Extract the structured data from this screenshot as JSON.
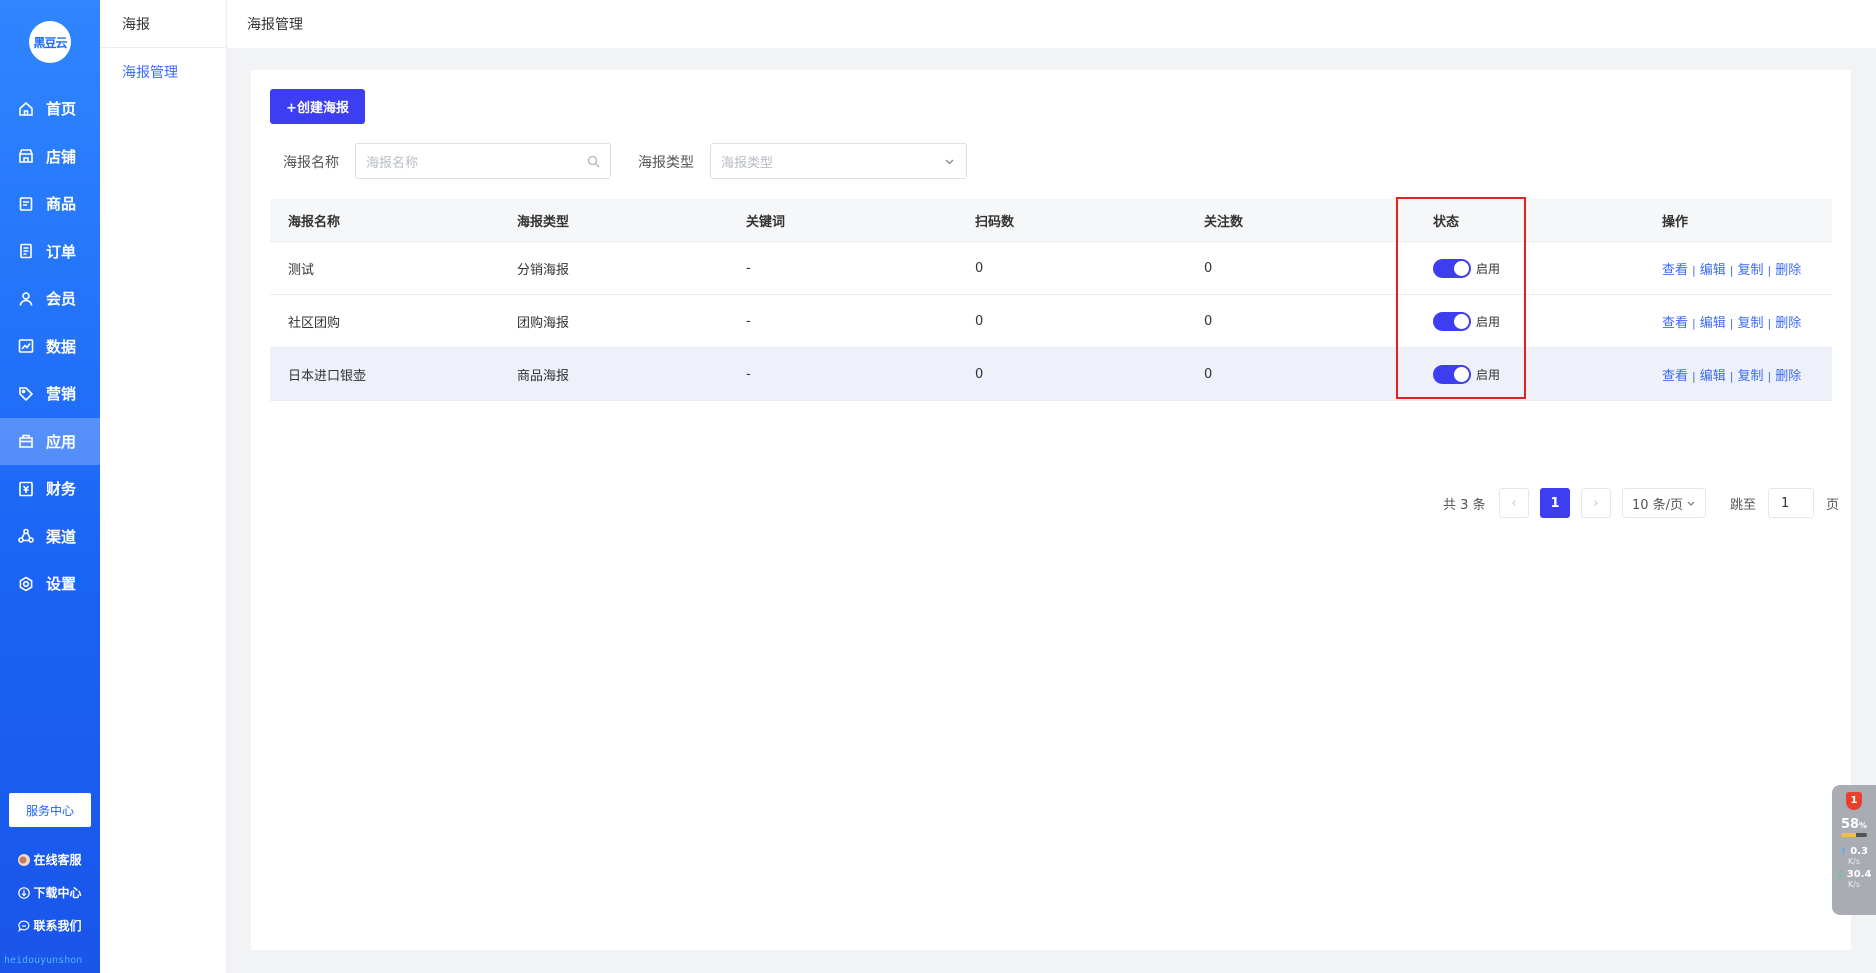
{
  "brand": {
    "logo_text": "黑豆云",
    "footer": "heidouyunshon"
  },
  "nav": {
    "items": [
      {
        "label": "首页",
        "icon": "home-icon"
      },
      {
        "label": "店铺",
        "icon": "store-icon"
      },
      {
        "label": "商品",
        "icon": "goods-icon"
      },
      {
        "label": "订单",
        "icon": "order-icon"
      },
      {
        "label": "会员",
        "icon": "member-icon"
      },
      {
        "label": "数据",
        "icon": "data-icon"
      },
      {
        "label": "营销",
        "icon": "tag-icon"
      },
      {
        "label": "应用",
        "icon": "app-icon",
        "active": true
      },
      {
        "label": "财务",
        "icon": "finance-icon"
      },
      {
        "label": "渠道",
        "icon": "channel-icon"
      },
      {
        "label": "设置",
        "icon": "settings-icon"
      }
    ],
    "service_center": "服务中心",
    "links": [
      "在线客服",
      "下载中心",
      "联系我们"
    ]
  },
  "subnav": {
    "title": "海报",
    "items": [
      "海报管理"
    ]
  },
  "breadcrumb": "海报管理",
  "toolbar": {
    "create_label": "+创建海报"
  },
  "filters": {
    "name_label": "海报名称",
    "name_placeholder": "海报名称",
    "type_label": "海报类型",
    "type_placeholder": "海报类型"
  },
  "table": {
    "columns": [
      "海报名称",
      "海报类型",
      "关键词",
      "扫码数",
      "关注数",
      "状态",
      "操作"
    ],
    "rows": [
      {
        "name": "测试",
        "type": "分销海报",
        "keyword": "-",
        "scans": "0",
        "follows": "0",
        "status": "启用",
        "enabled": true
      },
      {
        "name": "社区团购",
        "type": "团购海报",
        "keyword": "-",
        "scans": "0",
        "follows": "0",
        "status": "启用",
        "enabled": true
      },
      {
        "name": "日本进口银壶",
        "type": "商品海报",
        "keyword": "-",
        "scans": "0",
        "follows": "0",
        "status": "启用",
        "enabled": true
      }
    ],
    "actions": [
      "查看",
      "编辑",
      "复制",
      "删除"
    ],
    "action_sep": "|"
  },
  "pagination": {
    "total": "共 3 条",
    "prev": "‹",
    "current": "1",
    "next": "›",
    "page_size": "10 条/页",
    "jump_label": "跳至",
    "jump_value": "1",
    "page_suffix": "页"
  },
  "widget": {
    "badge": "1",
    "percent": "58",
    "percent_unit": "%",
    "cpu_fraction": 0.58,
    "up_speed": "0.3",
    "down_speed": "30.4",
    "speed_unit": "K/s"
  },
  "colors": {
    "accent": "#3d3df2",
    "sidebar": "#1f6af7",
    "link": "#3d6bf5",
    "highlight": "#e52020"
  }
}
